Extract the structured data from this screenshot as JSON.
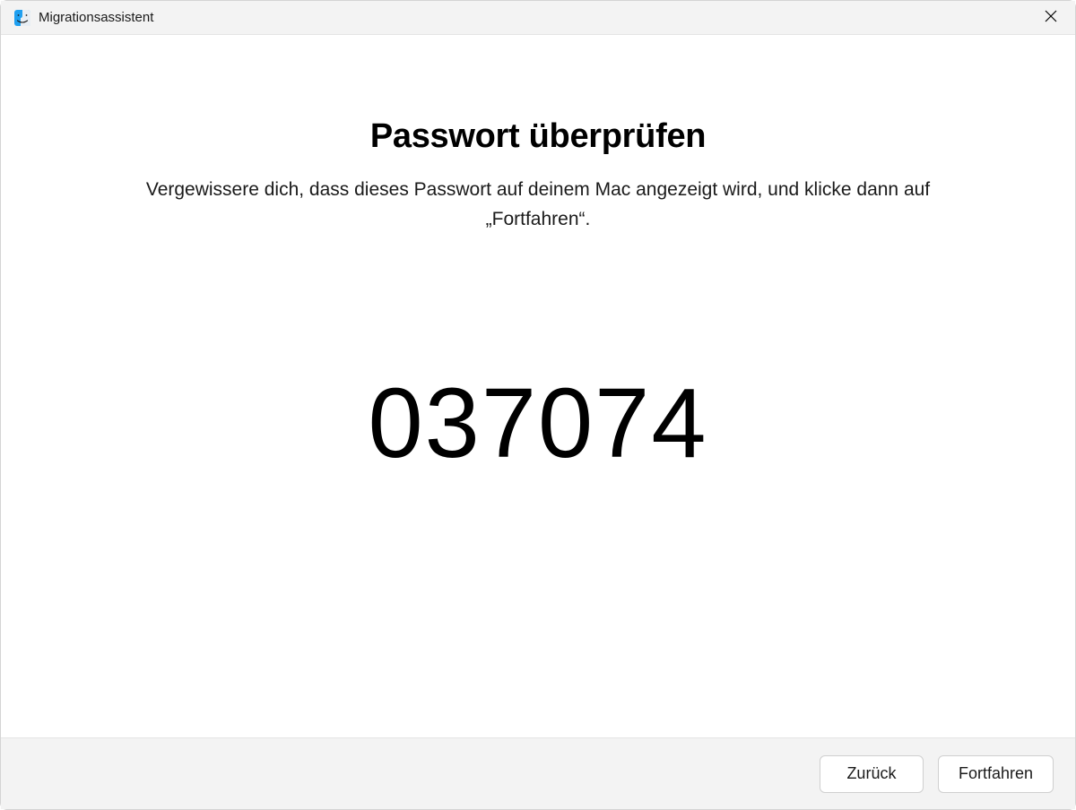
{
  "titlebar": {
    "title": "Migrationsassistent"
  },
  "main": {
    "heading": "Passwort überprüfen",
    "instruction": "Vergewissere dich, dass dieses Passwort auf deinem Mac angezeigt wird, und klicke dann auf „Fortfahren“.",
    "code": "037074"
  },
  "footer": {
    "back_label": "Zurück",
    "continue_label": "Fortfahren"
  }
}
